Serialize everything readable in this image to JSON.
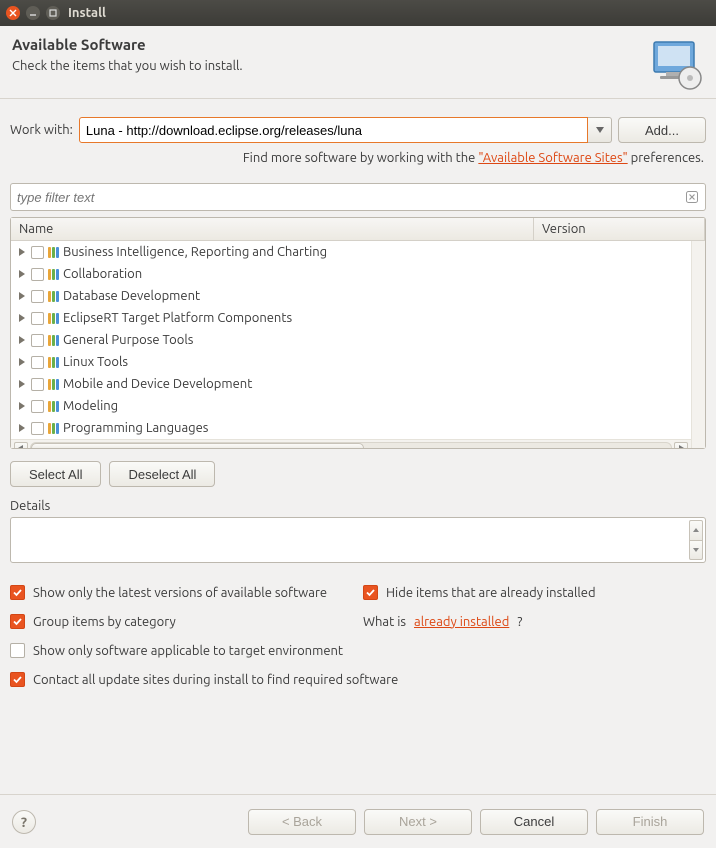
{
  "window": {
    "title": "Install"
  },
  "header": {
    "title": "Available Software",
    "subtitle": "Check the items that you wish to install."
  },
  "workwith": {
    "label": "Work with:",
    "value": "Luna - http://download.eclipse.org/releases/luna",
    "add_label": "Add..."
  },
  "findmore": {
    "prefix": "Find more software by working with the ",
    "link": "\"Available Software Sites\"",
    "suffix": " preferences."
  },
  "filter": {
    "placeholder": "type filter text"
  },
  "columns": {
    "name": "Name",
    "version": "Version"
  },
  "categories": [
    "Business Intelligence, Reporting and Charting",
    "Collaboration",
    "Database Development",
    "EclipseRT Target Platform Components",
    "General Purpose Tools",
    "Linux Tools",
    "Mobile and Device Development",
    "Modeling",
    "Programming Languages"
  ],
  "buttons": {
    "select_all": "Select All",
    "deselect_all": "Deselect All",
    "back": "< Back",
    "next": "Next >",
    "cancel": "Cancel",
    "finish": "Finish"
  },
  "details_label": "Details",
  "options": {
    "latest": "Show only the latest versions of available software",
    "hide_installed": "Hide items that are already installed",
    "group": "Group items by category",
    "whatis_prefix": "What is ",
    "whatis_link": "already installed",
    "whatis_suffix": "?",
    "target_env": "Show only software applicable to target environment",
    "contact_sites": "Contact all update sites during install to find required software"
  }
}
